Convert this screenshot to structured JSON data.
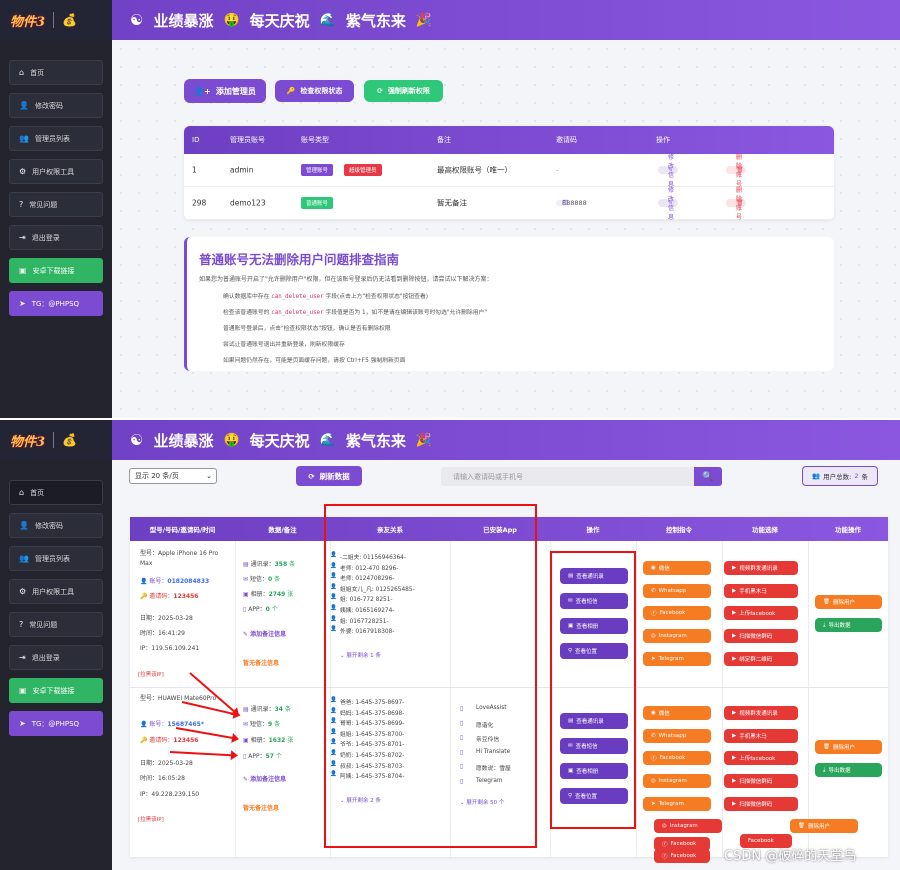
{
  "brand": {
    "logo_text": "物件3",
    "slogan_parts": [
      "业绩暴涨",
      "每天庆祝",
      "紫气东来"
    ]
  },
  "icons": {
    "brand_left": "yin-yang-icon",
    "em1": "money-face-icon",
    "em2": "party-popper-icon"
  },
  "sidebar": [
    {
      "label": "首页",
      "icon": "home-icon"
    },
    {
      "label": "修改密码",
      "icon": "user-icon"
    },
    {
      "label": "管理员列表",
      "icon": "users-icon"
    },
    {
      "label": "用户权限工具",
      "icon": "user-gear-icon"
    },
    {
      "label": "常见问题",
      "icon": "question-icon"
    },
    {
      "label": "退出登录",
      "icon": "logout-icon"
    },
    {
      "label": "安卓下载链接",
      "icon": "android-icon"
    },
    {
      "label": "TG：@PHPSQ",
      "icon": "telegram-icon"
    }
  ],
  "screen1": {
    "buttons": {
      "add_admin": "添加管理员",
      "check_perm": "检查权限状态",
      "force_refresh": "强制刷新权限"
    },
    "table": {
      "headers": [
        "ID",
        "管理员账号",
        "账号类型",
        "备注",
        "邀请码",
        "操作"
      ],
      "rows": [
        {
          "id": "1",
          "account": "admin",
          "type": "管理账号",
          "type2": "超级管理员",
          "note": "最高权限账号（唯一）",
          "code": "-",
          "edit": "修改信息",
          "delete": "删除账号"
        },
        {
          "id": "298",
          "account": "demo123",
          "type": "普通账号",
          "note": "暂无备注",
          "code": "888888",
          "edit": "修改信息",
          "delete": "删除账号"
        }
      ]
    },
    "guide": {
      "title": "普通账号无法删除用户问题排查指南",
      "intro": "如果您为普通账号开启了\"允许删除用户\"权限，但在该账号登录后仍无法看到删除按钮，请尝试以下解决方案：",
      "steps": [
        {
          "a": "确认数据库中存在 ",
          "code": "can_delete_user",
          "b": " 字段(点击上方\"检查权限状态\"按钮查看)"
        },
        {
          "a": "检查该普通账号的 ",
          "code": "can_delete_user",
          "b": " 字段值是否为 1，如不是请在编辑该账号时勾选\"允许删除用户\""
        },
        {
          "a": "普通账号登录后，点击\"检查权限状态\"按钮，确认是否有删除权限",
          "code": "",
          "b": ""
        },
        {
          "a": "尝试让普通账号退出并重新登录，刷新权限缓存",
          "code": "",
          "b": ""
        },
        {
          "a": "如果问题仍然存在，可能是页面缓存问题，请按 Ctrl+F5 强制刷新页面",
          "code": "",
          "b": ""
        }
      ]
    }
  },
  "screen2": {
    "per_page": "显示 20 条/页",
    "refresh": "刷新数据",
    "search_placeholder": "请输入邀请码或手机号",
    "total_label": "用户总数:",
    "total_value": "2",
    "total_unit": "条",
    "headers": [
      "型号/号码/邀请码/时间",
      "数据/备注",
      "亲友关系",
      "已安装App",
      "操作",
      "控制指令",
      "功能选择",
      "功能操作"
    ],
    "rows": [
      {
        "model": "型号：Apple iPhone 16 Pro Max",
        "phone_label": "账号：",
        "phone": "0182084833",
        "code_label": "邀请码：",
        "code": "123456",
        "date": "日期：2025-03-28",
        "time": "时间：16:41:29",
        "ip": "IP：119.56.109.241",
        "extra": "[拉黑该IP]",
        "contacts_label": "通讯录：",
        "contacts": "358",
        "sms_label": "短信：",
        "sms": "0",
        "photos_label": "相册：",
        "photos": "2749",
        "app_label": "APP：",
        "app": "0",
        "unit_item": "条",
        "unit_pic": "张",
        "unit_app": "个",
        "add_note": "添加备注信息",
        "no_note": "暂无备注信息",
        "relations": [
          "-二姐夫: 01156946364-",
          "老师: 012-470 8296-",
          "老师: 0124708296-",
          "姐姐女儿_凡: 0125265485-",
          "姐: 016-772 8251-",
          "姨姨: 0165169274-",
          "姐: 0167728251-",
          "外婆: 0167918308-"
        ],
        "rel_more": "展开剩余 1 条",
        "apps": [],
        "apps_more": ""
      },
      {
        "model": "型号：HUAWEI Mate60Pro",
        "phone_label": "账号：",
        "phone": "15687465*",
        "code_label": "邀请码：",
        "code": "123456",
        "date": "日期：2025-03-28",
        "time": "时间：16:05:28",
        "ip": "IP：49.228.239.150",
        "extra": "[拉黑该IP]",
        "contacts_label": "通讯录：",
        "contacts": "34",
        "sms_label": "短信：",
        "sms": "9",
        "photos_label": "相册：",
        "photos": "1632",
        "app_label": "APP：",
        "app": "57",
        "unit_item": "条",
        "unit_pic": "张",
        "unit_app": "个",
        "add_note": "添加备注信息",
        "no_note": "暂无备注信息",
        "relations": [
          "爸爸: 1-645-375-8697-",
          "妈妈: 1-645-375-8698-",
          "哥哥: 1-645-375-8699-",
          "姐姐: 1-645-375-8700-",
          "爷爷: 1-645-375-8701-",
          "奶奶: 1-645-375-8702-",
          "叔叔: 1-645-375-8703-",
          "阿姨: 1-645-375-8704-"
        ],
        "rel_more": "展开剩余 2 条",
        "apps": [
          "LoveAssist",
          "愿谐化",
          "亲豆伶信",
          "Hi Translate",
          "愿数说：雪屋",
          "Telegram"
        ],
        "apps_more": "展开剩余 50 个"
      }
    ],
    "ops": [
      "查看通讯录",
      "查看短信",
      "查看相册",
      "查看位置"
    ],
    "commands": [
      "微信",
      "Whatsapp",
      "Facebook",
      "Instagram",
      "Telegram"
    ],
    "functions1": [
      "视频群发通讯录",
      "手机黑木马",
      "上传facebook",
      "扫描微信群码",
      "绑定群二维码"
    ],
    "functions2": [
      "视频群发通讯录",
      "手机黑木马",
      "上传facebook",
      "扫描微信群码",
      "扫描微信群码"
    ],
    "actions": [
      "删除用户",
      "导出数据"
    ],
    "overflow": [
      "Instagram",
      "Facebook",
      "Facebook",
      "删除用户"
    ]
  },
  "watermark": "CSDN @破碎的天堂鸟"
}
